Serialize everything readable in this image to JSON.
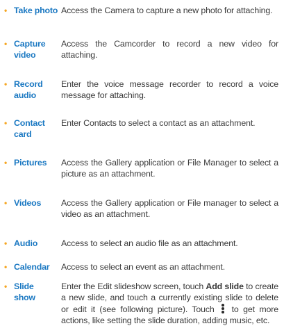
{
  "accent_colors": {
    "bullet": "#f5a623",
    "term": "#1a78c2",
    "text": "#3a3a3a"
  },
  "items": [
    {
      "term": "Take photo",
      "desc": "Access the Camera to capture a new photo for attaching."
    },
    {
      "term": "Capture video",
      "desc": "Access the Camcorder to record a new video for attaching."
    },
    {
      "term": "Record audio",
      "desc": "Enter the voice message recorder to record a voice message for attaching."
    },
    {
      "term": "Contact card",
      "desc": "Enter Contacts to select a contact as an attachment."
    },
    {
      "term": "Pictures",
      "desc": "Access the Gallery application or File Manager to select a picture as an attachment."
    },
    {
      "term": "Videos",
      "desc": "Access the Gallery application or File manager to select a video as an attachment."
    },
    {
      "term": "Audio",
      "desc": "Access to select an audio file as an attachment."
    },
    {
      "term": "Calendar",
      "desc": "Access to select an event as an attachment."
    },
    {
      "term": "Slide show",
      "desc_part1": "Enter the Edit slideshow screen, touch ",
      "desc_bold": "Add slide",
      "desc_part2": " to create a new slide, and touch a currently existing slide to delete or edit it (see following picture). Touch ",
      "desc_icon": "more-options-icon",
      "desc_part3": " to get more actions, like setting the slide duration, adding music, etc."
    }
  ]
}
